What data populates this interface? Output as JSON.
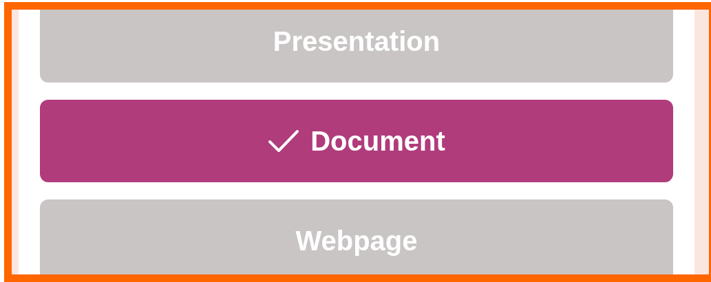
{
  "options": [
    {
      "label": "Presentation",
      "selected": false
    },
    {
      "label": "Document",
      "selected": true
    },
    {
      "label": "Webpage",
      "selected": false
    }
  ]
}
